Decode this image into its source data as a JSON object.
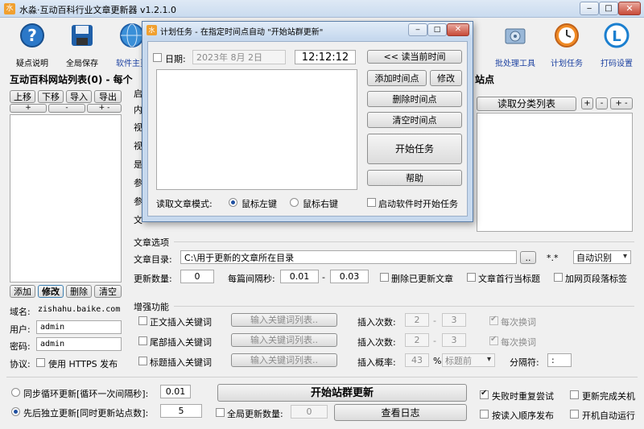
{
  "app": {
    "title": "水淼·互动百科行业文章更新器 v1.2.1.0"
  },
  "toolbar": {
    "items": [
      {
        "label": "疑点说明",
        "icon": "help-icon"
      },
      {
        "label": "全局保存",
        "icon": "save-icon"
      },
      {
        "label": "软件主页",
        "icon": "globe-icon"
      },
      {
        "label": "批处理工具",
        "icon": "batch-tool-icon"
      },
      {
        "label": "计划任务",
        "icon": "clock-icon"
      },
      {
        "label": "打码设置",
        "icon": "captcha-icon"
      }
    ]
  },
  "left": {
    "title": "互动百科网站列表(0) - 每个",
    "buttons": {
      "up": "上移",
      "down": "下移",
      "import": "导入",
      "export": "导出"
    },
    "mini": {
      "a": "+",
      "b": "-",
      "c": "+ -"
    },
    "actions": {
      "add": "添加",
      "edit": "修改",
      "delete": "删除",
      "clear": "清空"
    },
    "domain_label": "域名:",
    "domain_value": "zishahu.baike.com",
    "user_label": "用户:",
    "user_value": "admin",
    "pass_label": "密码:",
    "pass_value": "admin",
    "protocol_label": "协议:",
    "https_label": "使用 HTTPS 发布"
  },
  "middle": {
    "partial_labels": [
      "启",
      "内",
      "视",
      "视",
      "是",
      "参",
      "参",
      "文"
    ],
    "header_tail": "站点"
  },
  "right": {
    "read_category_button": "读取分类列表",
    "mini_buttons": [
      "+",
      "-",
      "+ -"
    ]
  },
  "article": {
    "section_title": "文章选项",
    "dir_label": "文章目录:",
    "dir_value": "C:\\用于更新的文章所在目录",
    "browse_button": "..",
    "ext_value": "*.*",
    "encoding_value": "自动识别",
    "update_count_label": "更新数量:",
    "update_count_value": "0",
    "interval_label": "每篇间隔秒:",
    "interval_min": "0.01",
    "interval_sep": "-",
    "interval_max": "0.03",
    "delete_updated_label": "删除已更新文章",
    "first_line_title_label": "文章首行当标题",
    "add_paragraph_tag_label": "加网页段落标签"
  },
  "enhance": {
    "section_title": "增强功能",
    "rows": [
      {
        "label": "正文插入关键词",
        "button": "输入关键词列表..",
        "count_label": "插入次数:",
        "min": "2",
        "max": "3",
        "extra": "每次换词"
      },
      {
        "label": "尾部插入关键词",
        "button": "输入关键词列表..",
        "count_label": "插入次数:",
        "min": "2",
        "max": "3",
        "extra": "每次换词"
      },
      {
        "label": "标题插入关键词",
        "button": "输入关键词列表..",
        "count_label": "插入概率:",
        "min": "43",
        "max": "%",
        "extra": "标题前"
      }
    ],
    "separator_label": "分隔符:",
    "separator_value": ":"
  },
  "bottom": {
    "sync_label": "同步循环更新[循环一次间隔秒]:",
    "sync_value": "0.01",
    "async_label": "先后独立更新[同时更新站点数]:",
    "async_value": "5",
    "start_button": "开始站群更新",
    "global_count_label": "全局更新数量:",
    "global_count_value": "0",
    "log_button": "查看日志",
    "retry_label": "失败时重复尝试",
    "shutdown_label": "更新完成关机",
    "order_label": "按读入顺序发布",
    "autorun_label": "开机自动运行"
  },
  "dialog": {
    "title": "计划任务 - 在指定时间点自动 \"开始站群更新\"",
    "date_label": "日期:",
    "date_value": "2023年  8月  2日",
    "time_value": "12:12:12",
    "read_time_button": "<< 读当前时间",
    "add_time_button": "添加时间点",
    "modify_button": "修改",
    "delete_time_button": "删除时间点",
    "clear_time_button": "清空时间点",
    "start_task_button": "开始任务",
    "help_button": "帮助",
    "read_mode_label": "读取文章模式:",
    "left_click_label": "鼠标左键",
    "right_click_label": "鼠标右键",
    "autostart_label": "启动软件时开始任务"
  }
}
